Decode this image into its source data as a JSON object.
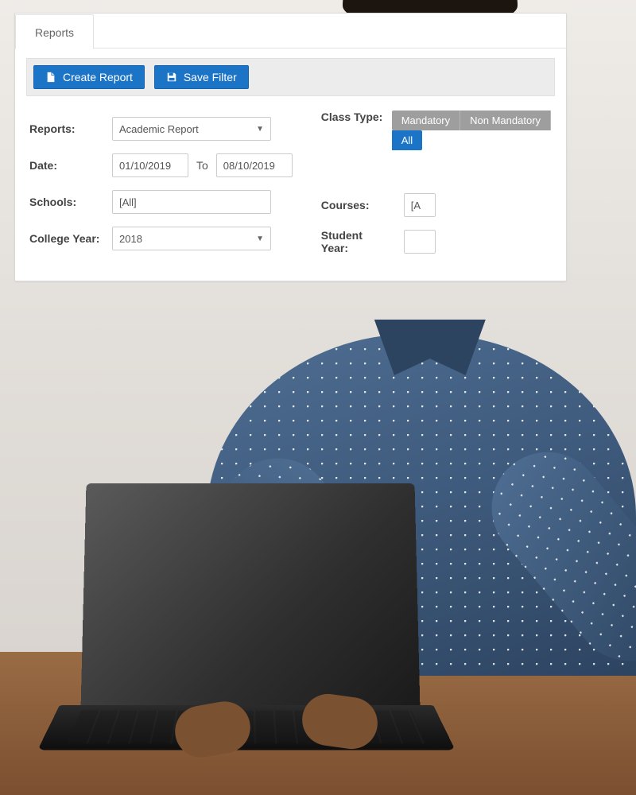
{
  "tab": {
    "label": "Reports"
  },
  "toolbar": {
    "create_label": "Create Report",
    "save_label": "Save Filter"
  },
  "labels": {
    "reports": "Reports:",
    "date": "Date:",
    "date_to": "To",
    "schools": "Schools:",
    "college_year": "College Year:",
    "class_type": "Class Type:",
    "courses": "Courses:",
    "student_year": "Student Year:"
  },
  "fields": {
    "report_type": "Academic Report",
    "date_from": "01/10/2019",
    "date_to": "08/10/2019",
    "schools": "[All]",
    "college_year": "2018",
    "courses": "[A",
    "student_year": ""
  },
  "class_type": {
    "options": [
      "Mandatory",
      "Non Mandatory",
      "All"
    ],
    "active_index": 2
  }
}
